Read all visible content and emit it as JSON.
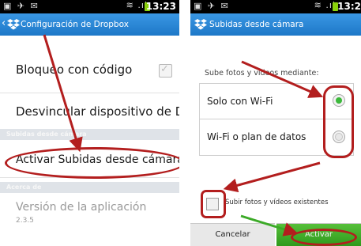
{
  "left": {
    "status": {
      "time": "13:23"
    },
    "actionbar": {
      "title": "Configuración de Dropbox"
    },
    "rows": {
      "lock": "Bloqueo con código",
      "unlink": "Desvincular dispositivo de D",
      "camera_uploads_section": "Subidas desde cámara",
      "activate": "Activar Subidas desde cámara",
      "about_section": "Acerca de",
      "version_title": "Versión de la aplicación",
      "version_value": "2.3.5"
    }
  },
  "right": {
    "status": {
      "time": "13:2"
    },
    "actionbar": {
      "title": "Subidas desde cámara"
    },
    "prompt": "Sube fotos y vídeos mediante:",
    "options": [
      {
        "label": "Solo con Wi-Fi",
        "selected": true
      },
      {
        "label": "Wi-Fi o plan de datos",
        "selected": false
      }
    ],
    "existing_checkbox_label": "Subir fotos y vídeos existentes",
    "buttons": {
      "cancel": "Cancelar",
      "activate": "Activar"
    }
  },
  "colors": {
    "actionbar": "#2a86d6",
    "annotation": "#b31e1e",
    "radio_selected": "#3cb93c",
    "activate_button": "#3caa28"
  }
}
